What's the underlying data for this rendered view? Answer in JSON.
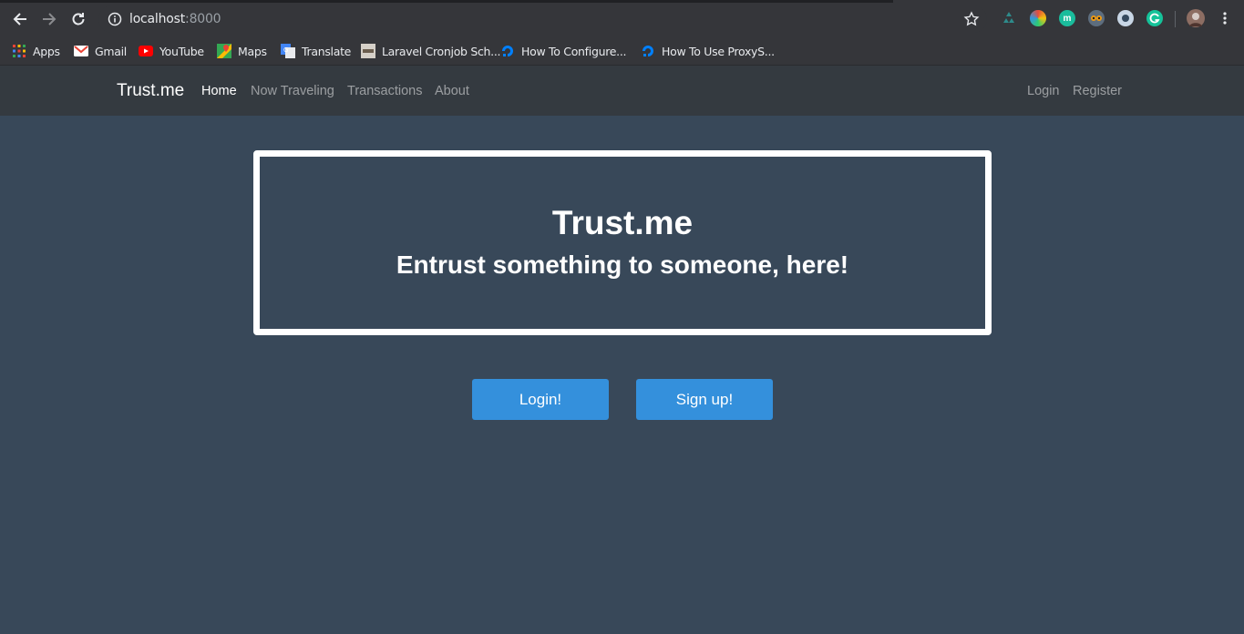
{
  "browser": {
    "url_host": "localhost",
    "url_port": ":8000",
    "bookmarks": [
      {
        "label": "Apps",
        "icon": "apps-grid-icon"
      },
      {
        "label": "Gmail",
        "icon": "gmail-icon"
      },
      {
        "label": "YouTube",
        "icon": "youtube-icon"
      },
      {
        "label": "Maps",
        "icon": "maps-icon"
      },
      {
        "label": "Translate",
        "icon": "translate-icon"
      },
      {
        "label": "Laravel Cronjob Sch...",
        "icon": "laravel-favicon"
      },
      {
        "label": "How To Configure...",
        "icon": "digitalocean-icon"
      },
      {
        "label": "How To Use ProxyS...",
        "icon": "digitalocean-icon"
      }
    ],
    "extension_badge": "m"
  },
  "navbar": {
    "brand": "Trust.me",
    "links": [
      "Home",
      "Now Traveling",
      "Transactions",
      "About"
    ],
    "auth_links": [
      "Login",
      "Register"
    ]
  },
  "hero": {
    "title": "Trust.me",
    "subtitle": "Entrust something to someone, here!"
  },
  "actions": {
    "login_label": "Login!",
    "signup_label": "Sign up!"
  },
  "colors": {
    "page_bg": "#384859",
    "navbar_bg": "#343a40",
    "button_bg": "#3490dc"
  }
}
